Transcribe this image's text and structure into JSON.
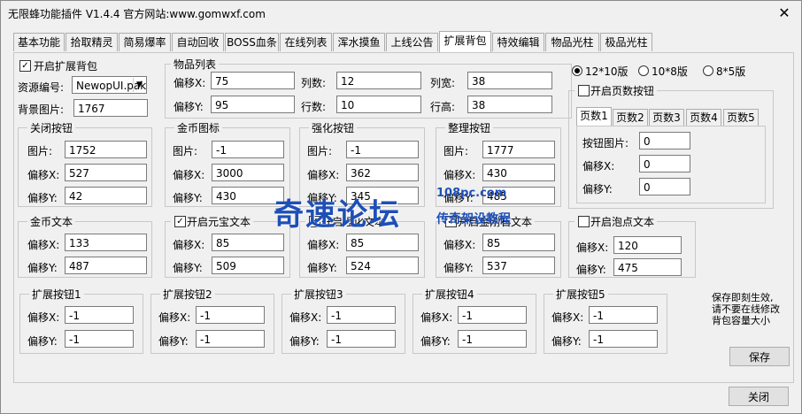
{
  "window": {
    "title": "无限蜂功能插件 V1.4.4  官方网站:www.gomwxf.com"
  },
  "tabs": [
    "基本功能",
    "拾取精灵",
    "简易爆率",
    "自动回收",
    "BOSS血条",
    "在线列表",
    "浑水摸鱼",
    "上线公告",
    "扩展背包",
    "特效编辑",
    "物品光柱",
    "极品光柱"
  ],
  "active_tab": "扩展背包",
  "enable_bag": {
    "label": "开启扩展背包",
    "checked": true
  },
  "resource": {
    "label": "资源编号:",
    "value": "NewopUI.pak"
  },
  "bg_image": {
    "label": "背景图片:",
    "value": "1767"
  },
  "item_list": {
    "title": "物品列表",
    "offset_x_label": "偏移X:",
    "offset_x": "75",
    "offset_y_label": "偏移Y:",
    "offset_y": "95",
    "cols_label": "列数:",
    "cols": "12",
    "rows_label": "行数:",
    "rows": "10",
    "col_width_label": "列宽:",
    "col_width": "38",
    "row_height_label": "行高:",
    "row_height": "38"
  },
  "groups_img": [
    {
      "title": "关闭按钮",
      "img": "1752",
      "ox": "527",
      "oy": "42"
    },
    {
      "title": "金币图标",
      "img": "-1",
      "ox": "3000",
      "oy": "430"
    },
    {
      "title": "强化按钮",
      "img": "-1",
      "ox": "362",
      "oy": "345"
    },
    {
      "title": "整理按钮",
      "img": "1777",
      "ox": "430",
      "oy": "485"
    }
  ],
  "labels": {
    "img": "图片:",
    "ox": "偏移X:",
    "oy": "偏移Y:"
  },
  "groups_text": [
    {
      "title": "金币文本",
      "checkbox": false,
      "checked": false,
      "ox": "133",
      "oy": "487"
    },
    {
      "title": "开启元宝文本",
      "checkbox": true,
      "checked": true,
      "ox": "85",
      "oy": "509"
    },
    {
      "title": "开启强化文本",
      "checkbox": true,
      "checked": true,
      "ox": "85",
      "oy": "524"
    },
    {
      "title": "开启金刚石文本",
      "checkbox": true,
      "checked": true,
      "ox": "85",
      "oy": "537"
    }
  ],
  "bubble": {
    "title": "开启泡点文本",
    "checked": false,
    "ox": "120",
    "oy": "475"
  },
  "layouts": [
    {
      "label": "12*10版",
      "selected": true
    },
    {
      "label": "10*8版",
      "selected": false
    },
    {
      "label": "8*5版",
      "selected": false
    }
  ],
  "page_buttons": {
    "title": "开启页数按钮",
    "checked": false,
    "tabs": [
      "页数1",
      "页数2",
      "页数3",
      "页数4",
      "页数5"
    ],
    "img_label": "按钮图片:",
    "img": "0",
    "ox_label": "偏移X:",
    "ox": "0",
    "oy_label": "偏移Y:",
    "oy": "0"
  },
  "ext_buttons": [
    {
      "title": "扩展按钮1",
      "ox": "-1",
      "oy": "-1"
    },
    {
      "title": "扩展按钮2",
      "ox": "-1",
      "oy": "-1"
    },
    {
      "title": "扩展按钮3",
      "ox": "-1",
      "oy": "-1"
    },
    {
      "title": "扩展按钮4",
      "ox": "-1",
      "oy": "-1"
    },
    {
      "title": "扩展按钮5",
      "ox": "-1",
      "oy": "-1"
    }
  ],
  "note": {
    "line1": "保存即刻生效,",
    "line2": "请不要在线修改",
    "line3": "背包容量大小"
  },
  "save_label": "保存",
  "close_label": "关闭",
  "watermark": {
    "main": "奇速论坛",
    "url": "108pc.com",
    "sub": "传奇架设教程"
  }
}
